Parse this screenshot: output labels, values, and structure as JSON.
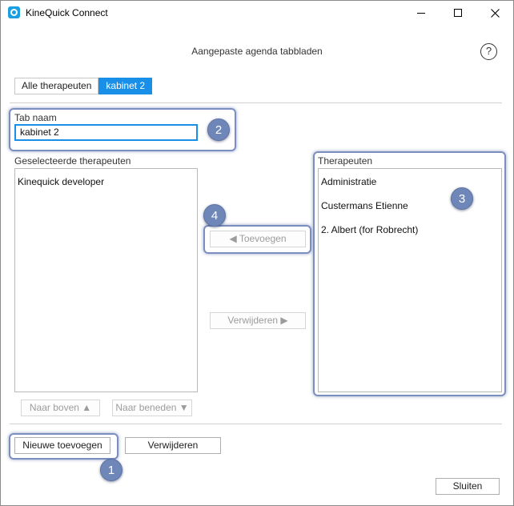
{
  "window": {
    "title": "KineQuick Connect"
  },
  "header": {
    "title": "Aangepaste agenda tabbladen",
    "help_glyph": "?"
  },
  "tabs": [
    {
      "label": "Alle therapeuten",
      "active": false
    },
    {
      "label": "kabinet 2",
      "active": true
    }
  ],
  "tab_name": {
    "label": "Tab naam",
    "value": "kabinet 2"
  },
  "selected": {
    "label": "Geselecteerde therapeuten",
    "items": [
      "Kinequick developer"
    ],
    "up_label": "Naar boven ▲",
    "down_label": "Naar beneden ▼"
  },
  "therapists": {
    "label": "Therapeuten",
    "items": [
      "Administratie",
      "Custermans Etienne",
      "2. Albert (for Robrecht)"
    ]
  },
  "actions": {
    "add_label": "◀ Toevoegen",
    "remove_label": "Verwijderen ▶"
  },
  "footer": {
    "new_label": "Nieuwe toevoegen",
    "delete_label": "Verwijderen",
    "close_label": "Sluiten"
  },
  "annotations": [
    "1",
    "2",
    "3",
    "4"
  ],
  "colors": {
    "accent": "#1a8fe8",
    "annotation": "#6f87b8"
  }
}
